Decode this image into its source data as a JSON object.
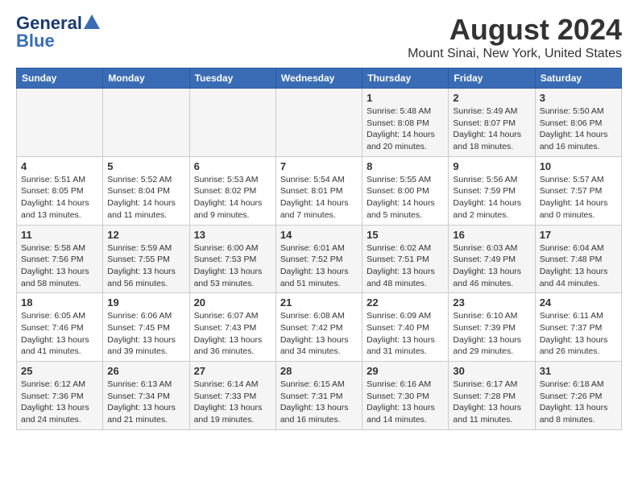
{
  "logo": {
    "line1": "General",
    "line2": "Blue"
  },
  "title": "August 2024",
  "subtitle": "Mount Sinai, New York, United States",
  "days_of_week": [
    "Sunday",
    "Monday",
    "Tuesday",
    "Wednesday",
    "Thursday",
    "Friday",
    "Saturday"
  ],
  "weeks": [
    [
      {
        "day": "",
        "info": ""
      },
      {
        "day": "",
        "info": ""
      },
      {
        "day": "",
        "info": ""
      },
      {
        "day": "",
        "info": ""
      },
      {
        "day": "1",
        "info": "Sunrise: 5:48 AM\nSunset: 8:08 PM\nDaylight: 14 hours and 20 minutes."
      },
      {
        "day": "2",
        "info": "Sunrise: 5:49 AM\nSunset: 8:07 PM\nDaylight: 14 hours and 18 minutes."
      },
      {
        "day": "3",
        "info": "Sunrise: 5:50 AM\nSunset: 8:06 PM\nDaylight: 14 hours and 16 minutes."
      }
    ],
    [
      {
        "day": "4",
        "info": "Sunrise: 5:51 AM\nSunset: 8:05 PM\nDaylight: 14 hours and 13 minutes."
      },
      {
        "day": "5",
        "info": "Sunrise: 5:52 AM\nSunset: 8:04 PM\nDaylight: 14 hours and 11 minutes."
      },
      {
        "day": "6",
        "info": "Sunrise: 5:53 AM\nSunset: 8:02 PM\nDaylight: 14 hours and 9 minutes."
      },
      {
        "day": "7",
        "info": "Sunrise: 5:54 AM\nSunset: 8:01 PM\nDaylight: 14 hours and 7 minutes."
      },
      {
        "day": "8",
        "info": "Sunrise: 5:55 AM\nSunset: 8:00 PM\nDaylight: 14 hours and 5 minutes."
      },
      {
        "day": "9",
        "info": "Sunrise: 5:56 AM\nSunset: 7:59 PM\nDaylight: 14 hours and 2 minutes."
      },
      {
        "day": "10",
        "info": "Sunrise: 5:57 AM\nSunset: 7:57 PM\nDaylight: 14 hours and 0 minutes."
      }
    ],
    [
      {
        "day": "11",
        "info": "Sunrise: 5:58 AM\nSunset: 7:56 PM\nDaylight: 13 hours and 58 minutes."
      },
      {
        "day": "12",
        "info": "Sunrise: 5:59 AM\nSunset: 7:55 PM\nDaylight: 13 hours and 56 minutes."
      },
      {
        "day": "13",
        "info": "Sunrise: 6:00 AM\nSunset: 7:53 PM\nDaylight: 13 hours and 53 minutes."
      },
      {
        "day": "14",
        "info": "Sunrise: 6:01 AM\nSunset: 7:52 PM\nDaylight: 13 hours and 51 minutes."
      },
      {
        "day": "15",
        "info": "Sunrise: 6:02 AM\nSunset: 7:51 PM\nDaylight: 13 hours and 48 minutes."
      },
      {
        "day": "16",
        "info": "Sunrise: 6:03 AM\nSunset: 7:49 PM\nDaylight: 13 hours and 46 minutes."
      },
      {
        "day": "17",
        "info": "Sunrise: 6:04 AM\nSunset: 7:48 PM\nDaylight: 13 hours and 44 minutes."
      }
    ],
    [
      {
        "day": "18",
        "info": "Sunrise: 6:05 AM\nSunset: 7:46 PM\nDaylight: 13 hours and 41 minutes."
      },
      {
        "day": "19",
        "info": "Sunrise: 6:06 AM\nSunset: 7:45 PM\nDaylight: 13 hours and 39 minutes."
      },
      {
        "day": "20",
        "info": "Sunrise: 6:07 AM\nSunset: 7:43 PM\nDaylight: 13 hours and 36 minutes."
      },
      {
        "day": "21",
        "info": "Sunrise: 6:08 AM\nSunset: 7:42 PM\nDaylight: 13 hours and 34 minutes."
      },
      {
        "day": "22",
        "info": "Sunrise: 6:09 AM\nSunset: 7:40 PM\nDaylight: 13 hours and 31 minutes."
      },
      {
        "day": "23",
        "info": "Sunrise: 6:10 AM\nSunset: 7:39 PM\nDaylight: 13 hours and 29 minutes."
      },
      {
        "day": "24",
        "info": "Sunrise: 6:11 AM\nSunset: 7:37 PM\nDaylight: 13 hours and 26 minutes."
      }
    ],
    [
      {
        "day": "25",
        "info": "Sunrise: 6:12 AM\nSunset: 7:36 PM\nDaylight: 13 hours and 24 minutes."
      },
      {
        "day": "26",
        "info": "Sunrise: 6:13 AM\nSunset: 7:34 PM\nDaylight: 13 hours and 21 minutes."
      },
      {
        "day": "27",
        "info": "Sunrise: 6:14 AM\nSunset: 7:33 PM\nDaylight: 13 hours and 19 minutes."
      },
      {
        "day": "28",
        "info": "Sunrise: 6:15 AM\nSunset: 7:31 PM\nDaylight: 13 hours and 16 minutes."
      },
      {
        "day": "29",
        "info": "Sunrise: 6:16 AM\nSunset: 7:30 PM\nDaylight: 13 hours and 14 minutes."
      },
      {
        "day": "30",
        "info": "Sunrise: 6:17 AM\nSunset: 7:28 PM\nDaylight: 13 hours and 11 minutes."
      },
      {
        "day": "31",
        "info": "Sunrise: 6:18 AM\nSunset: 7:26 PM\nDaylight: 13 hours and 8 minutes."
      }
    ]
  ]
}
